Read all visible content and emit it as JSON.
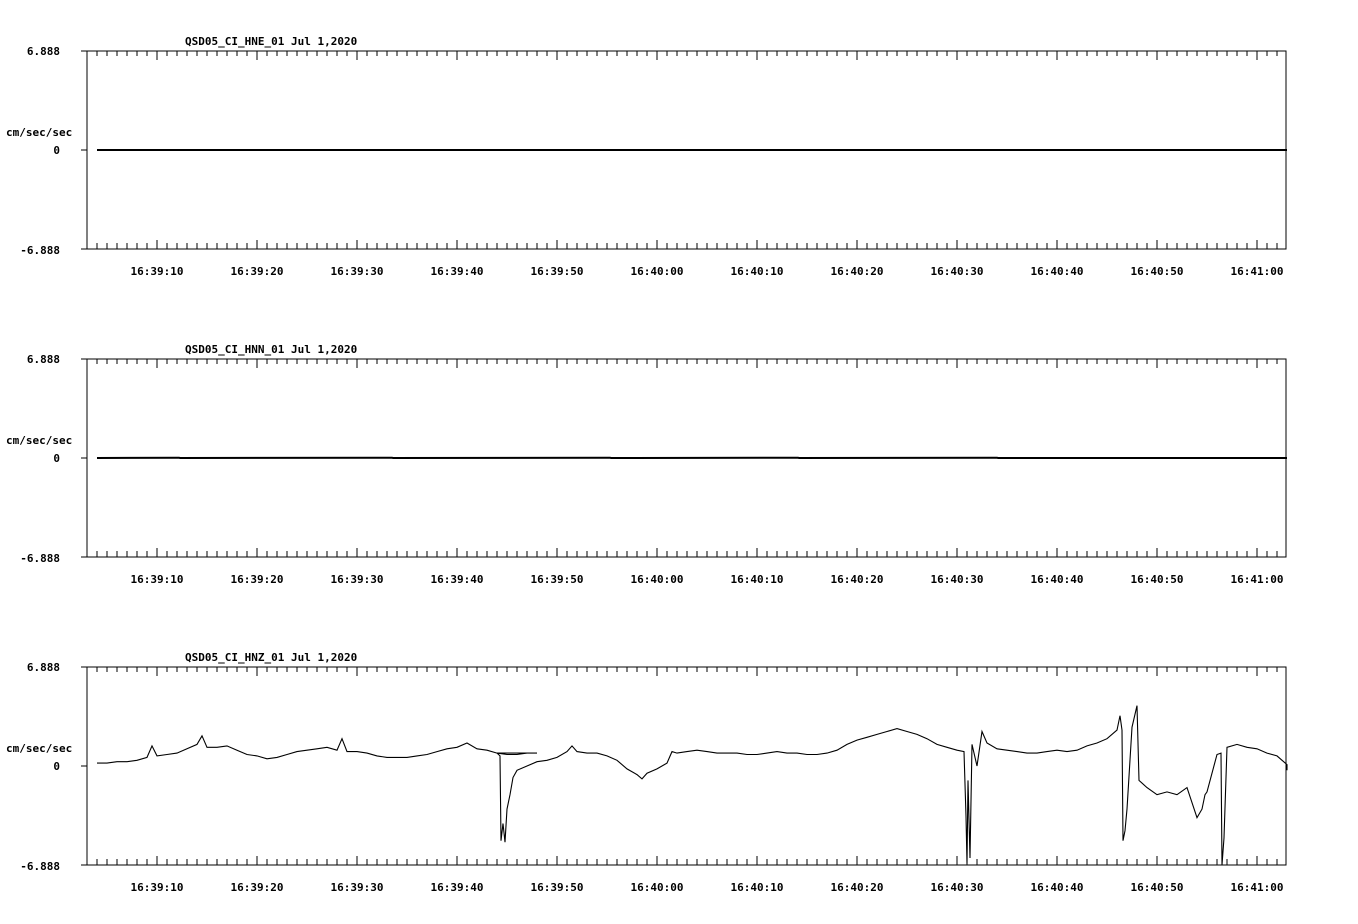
{
  "chart_data": [
    {
      "type": "line",
      "title": "QSD05_CI_HNE_01  Jul 1,2020",
      "ylabel": "cm/sec/sec",
      "ylim": [
        -6.888,
        6.888
      ],
      "y_tick_labels": [
        "6.888",
        "0",
        "-6.888"
      ],
      "x_tick_labels": [
        "16:39:10",
        "16:39:20",
        "16:39:30",
        "16:39:40",
        "16:39:50",
        "16:40:00",
        "16:40:10",
        "16:40:20",
        "16:40:30",
        "16:40:40",
        "16:40:50",
        "16:41:00"
      ],
      "series": [
        {
          "points": [
            [
              0,
              0
            ],
            [
              119,
              0
            ]
          ]
        }
      ]
    },
    {
      "type": "line",
      "title": "QSD05_CI_HNN_01  Jul 1,2020",
      "ylabel": "cm/sec/sec",
      "ylim": [
        -6.888,
        6.888
      ],
      "y_tick_labels": [
        "6.888",
        "0",
        "-6.888"
      ],
      "x_tick_labels": [
        "16:39:10",
        "16:39:20",
        "16:39:30",
        "16:39:40",
        "16:39:50",
        "16:40:00",
        "16:40:10",
        "16:40:20",
        "16:40:30",
        "16:40:40",
        "16:40:50",
        "16:41:00"
      ],
      "series": [
        {
          "points": [
            [
              0,
              0
            ],
            [
              8.2,
              0.02
            ],
            [
              8.3,
              0
            ],
            [
              29.5,
              0.02
            ],
            [
              29.6,
              0
            ],
            [
              51.3,
              0.02
            ],
            [
              51.4,
              0
            ],
            [
              70.1,
              0.02
            ],
            [
              70.2,
              0
            ],
            [
              90,
              0.02
            ],
            [
              90.1,
              0
            ],
            [
              119,
              0
            ]
          ]
        }
      ]
    },
    {
      "type": "line",
      "title": "QSD05_CI_HNZ_01  Jul 1,2020",
      "ylabel": "cm/sec/sec",
      "ylim": [
        -6.888,
        6.888
      ],
      "y_tick_labels": [
        "6.888",
        "0",
        "-6.888"
      ],
      "x_tick_labels": [
        "16:39:10",
        "16:39:20",
        "16:39:30",
        "16:39:40",
        "16:39:50",
        "16:40:00",
        "16:40:10",
        "16:40:20",
        "16:40:30",
        "16:40:40",
        "16:40:50",
        "16:41:00"
      ],
      "series": [
        {
          "points": [
            [
              0,
              0.2
            ],
            [
              1,
              0.2
            ],
            [
              2,
              0.3
            ],
            [
              3,
              0.3
            ],
            [
              4,
              0.4
            ],
            [
              5,
              0.6
            ],
            [
              5.5,
              1.4
            ],
            [
              6,
              0.7
            ],
            [
              7,
              0.8
            ],
            [
              8,
              0.9
            ],
            [
              9,
              1.2
            ],
            [
              10,
              1.5
            ],
            [
              10.5,
              2.1
            ],
            [
              11,
              1.3
            ],
            [
              12,
              1.3
            ],
            [
              13,
              1.4
            ],
            [
              14,
              1.1
            ],
            [
              15,
              0.8
            ],
            [
              16,
              0.7
            ],
            [
              17,
              0.5
            ],
            [
              18,
              0.6
            ],
            [
              19,
              0.8
            ],
            [
              20,
              1.0
            ],
            [
              21,
              1.1
            ],
            [
              22,
              1.2
            ],
            [
              23,
              1.3
            ],
            [
              24,
              1.1
            ],
            [
              24.5,
              1.9
            ],
            [
              25,
              1.0
            ],
            [
              26,
              1.0
            ],
            [
              27,
              0.9
            ],
            [
              28,
              0.7
            ],
            [
              29,
              0.6
            ],
            [
              30,
              0.6
            ],
            [
              31,
              0.6
            ],
            [
              32,
              0.7
            ],
            [
              33,
              0.8
            ],
            [
              34,
              1.0
            ],
            [
              35,
              1.2
            ],
            [
              36,
              1.3
            ],
            [
              37,
              1.6
            ],
            [
              38,
              1.2
            ],
            [
              39,
              1.1
            ],
            [
              40,
              0.9
            ],
            [
              41,
              0.8
            ],
            [
              42,
              0.8
            ],
            [
              43,
              0.9
            ],
            [
              44,
              0.9
            ],
            [
              40.0,
              0.9
            ],
            [
              40.3,
              0.7
            ],
            [
              40.4,
              -5.2
            ],
            [
              40.6,
              -4.0
            ],
            [
              40.8,
              -5.3
            ],
            [
              41.0,
              -3.0
            ],
            [
              41.3,
              -2.0
            ],
            [
              41.6,
              -0.8
            ],
            [
              42,
              -0.3
            ],
            [
              43,
              0.0
            ],
            [
              44,
              0.3
            ],
            [
              45,
              0.4
            ],
            [
              46,
              0.6
            ],
            [
              47,
              1.0
            ],
            [
              47.5,
              1.4
            ],
            [
              48,
              1.0
            ],
            [
              49,
              0.9
            ],
            [
              50,
              0.9
            ],
            [
              51,
              0.7
            ],
            [
              52,
              0.4
            ],
            [
              53,
              -0.2
            ],
            [
              54,
              -0.6
            ],
            [
              54.5,
              -0.9
            ],
            [
              55,
              -0.5
            ],
            [
              56,
              -0.2
            ],
            [
              57,
              0.2
            ],
            [
              57.5,
              1.0
            ],
            [
              58,
              0.9
            ],
            [
              59,
              1.0
            ],
            [
              60,
              1.1
            ],
            [
              61,
              1.0
            ],
            [
              62,
              0.9
            ],
            [
              63,
              0.9
            ],
            [
              64,
              0.9
            ],
            [
              65,
              0.8
            ],
            [
              66,
              0.8
            ],
            [
              67,
              0.9
            ],
            [
              68,
              1.0
            ],
            [
              69,
              0.9
            ],
            [
              70,
              0.9
            ],
            [
              71,
              0.8
            ],
            [
              72,
              0.8
            ],
            [
              73,
              0.9
            ],
            [
              74,
              1.1
            ],
            [
              75,
              1.5
            ],
            [
              76,
              1.8
            ],
            [
              77,
              2.0
            ],
            [
              78,
              2.2
            ],
            [
              79,
              2.4
            ],
            [
              80,
              2.6
            ],
            [
              81,
              2.4
            ],
            [
              82,
              2.2
            ],
            [
              83,
              1.9
            ],
            [
              84,
              1.5
            ],
            [
              85,
              1.3
            ],
            [
              86,
              1.1
            ],
            [
              86.7,
              1.0
            ],
            [
              86.9,
              -3.5
            ],
            [
              87.0,
              -6.8
            ],
            [
              87.1,
              -1.0
            ],
            [
              87.3,
              -6.4
            ],
            [
              87.5,
              1.5
            ],
            [
              88,
              0.0
            ],
            [
              88.5,
              2.4
            ],
            [
              89,
              1.6
            ],
            [
              90,
              1.2
            ],
            [
              91,
              1.1
            ],
            [
              92,
              1.0
            ],
            [
              93,
              0.9
            ],
            [
              94,
              0.9
            ],
            [
              95,
              1.0
            ],
            [
              96,
              1.1
            ],
            [
              97,
              1.0
            ],
            [
              98,
              1.1
            ],
            [
              99,
              1.4
            ],
            [
              100,
              1.6
            ],
            [
              101,
              1.9
            ],
            [
              102,
              2.5
            ],
            [
              102.3,
              3.5
            ],
            [
              102.5,
              2.5
            ],
            [
              102.6,
              -5.2
            ],
            [
              102.8,
              -4.5
            ],
            [
              103,
              -3.0
            ],
            [
              103.5,
              2.7
            ],
            [
              104,
              4.2
            ],
            [
              104.2,
              -1.0
            ],
            [
              105,
              -1.5
            ],
            [
              106,
              -2.0
            ],
            [
              107,
              -1.8
            ],
            [
              108,
              -2.0
            ],
            [
              109,
              -1.5
            ],
            [
              110,
              -3.6
            ],
            [
              110.5,
              -3.0
            ],
            [
              110.8,
              -2.0
            ],
            [
              111,
              -1.8
            ],
            [
              112,
              0.8
            ],
            [
              112.4,
              0.9
            ],
            [
              112.5,
              -6.888
            ],
            [
              112.7,
              -5.0
            ],
            [
              113,
              1.3
            ],
            [
              114,
              1.5
            ],
            [
              115,
              1.3
            ],
            [
              116,
              1.2
            ],
            [
              117,
              0.9
            ],
            [
              118,
              0.7
            ],
            [
              119,
              0.1
            ],
            [
              119,
              -0.3
            ]
          ]
        }
      ]
    }
  ]
}
